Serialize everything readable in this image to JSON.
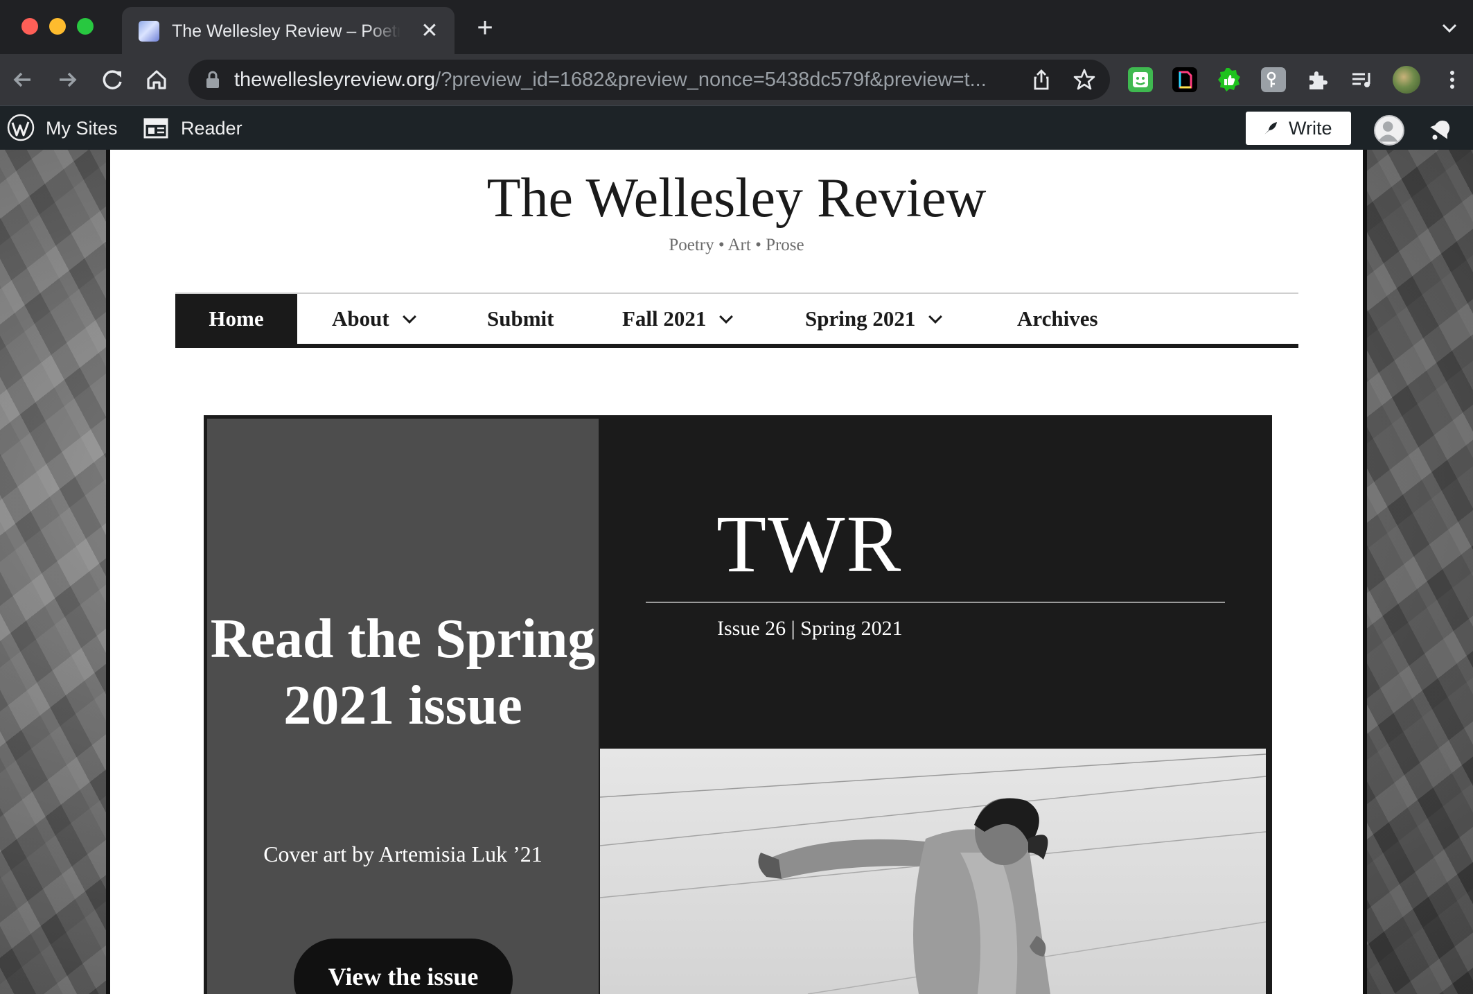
{
  "browser": {
    "tab_title": "The Wellesley Review – Poetry • Art • Prose",
    "url_host": "thewellesleyreview.org",
    "url_rest": "/?preview_id=1682&preview_nonce=5438dc579f&preview=t..."
  },
  "wp_admin_bar": {
    "my_sites_label": "My Sites",
    "reader_label": "Reader",
    "write_label": "Write"
  },
  "site": {
    "title": "The Wellesley Review",
    "description": "Poetry • Art • Prose"
  },
  "nav": {
    "items": [
      {
        "label": "Home",
        "active": true,
        "has_submenu": false
      },
      {
        "label": "About",
        "active": false,
        "has_submenu": true
      },
      {
        "label": "Submit",
        "active": false,
        "has_submenu": false
      },
      {
        "label": "Fall 2021",
        "active": false,
        "has_submenu": true
      },
      {
        "label": "Spring 2021",
        "active": false,
        "has_submenu": true
      },
      {
        "label": "Archives",
        "active": false,
        "has_submenu": false
      }
    ]
  },
  "feature": {
    "heading": "Read the Spring 2021 issue",
    "cover_credit": "Cover art by Artemisia Luk ’21",
    "view_button_label": "View the issue",
    "logo_text": "TWR",
    "issue_text": "Issue 26 | Spring 2021"
  },
  "colors": {
    "chrome_dark": "#202124",
    "chrome_toolbar": "#35363a",
    "wp_bar": "#1d2327",
    "feature_dark": "#1b1b1b",
    "feature_panel": "#4d4d4d"
  }
}
